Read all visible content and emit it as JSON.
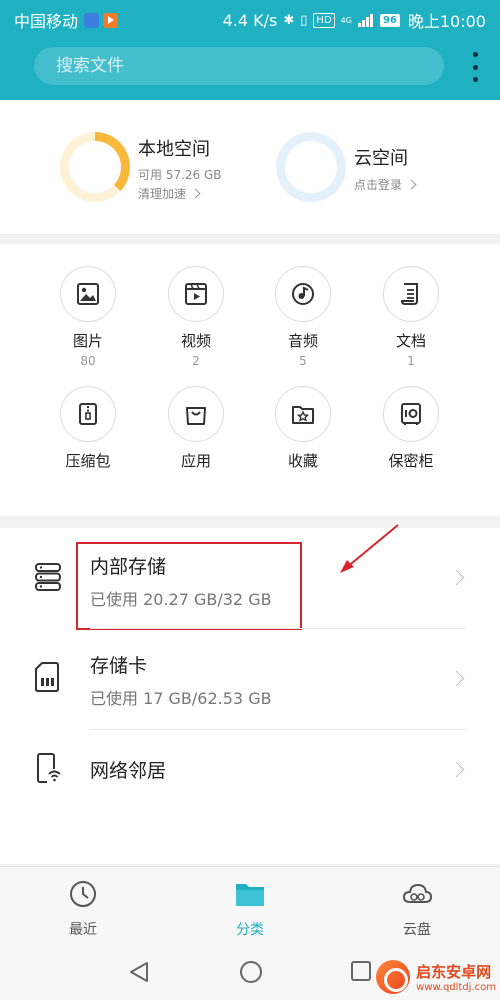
{
  "status_bar": {
    "carrier": "中国移动",
    "speed": "4.4 K/s",
    "battery": "96",
    "time": "晚上10:00",
    "network_label": "4G"
  },
  "search": {
    "placeholder": "搜索文件"
  },
  "storage": {
    "local": {
      "title": "本地空间",
      "available": "可用 57.26 GB",
      "action": "清理加速",
      "used_fraction": 0.37
    },
    "cloud": {
      "title": "云空间",
      "action": "点击登录"
    }
  },
  "categories": [
    {
      "label": "图片",
      "count": "80",
      "icon": "image-icon"
    },
    {
      "label": "视频",
      "count": "2",
      "icon": "video-icon"
    },
    {
      "label": "音频",
      "count": "5",
      "icon": "audio-icon"
    },
    {
      "label": "文档",
      "count": "1",
      "icon": "document-icon"
    },
    {
      "label": "压缩包",
      "icon": "archive-icon"
    },
    {
      "label": "应用",
      "icon": "app-bag-icon"
    },
    {
      "label": "收藏",
      "icon": "favorite-folder-icon"
    },
    {
      "label": "保密柜",
      "icon": "safe-icon"
    }
  ],
  "locations": [
    {
      "title": "内部存储",
      "usage": "已使用 20.27 GB/32 GB",
      "icon": "internal-storage-icon"
    },
    {
      "title": "存储卡",
      "usage": "已使用 17 GB/62.53 GB",
      "icon": "sd-card-icon"
    },
    {
      "title": "网络邻居",
      "icon": "network-device-icon"
    }
  ],
  "tabs": [
    {
      "label": "最近",
      "icon": "clock-icon"
    },
    {
      "label": "分类",
      "icon": "folder-icon",
      "active": true
    },
    {
      "label": "云盘",
      "icon": "cloud-icon"
    }
  ],
  "watermark": {
    "title": "启东安卓网",
    "url": "www.qdltdj.com"
  },
  "colors": {
    "accent": "#1fb0c2",
    "local_ring": "#f7b83c",
    "highlight": "#d6262c"
  }
}
